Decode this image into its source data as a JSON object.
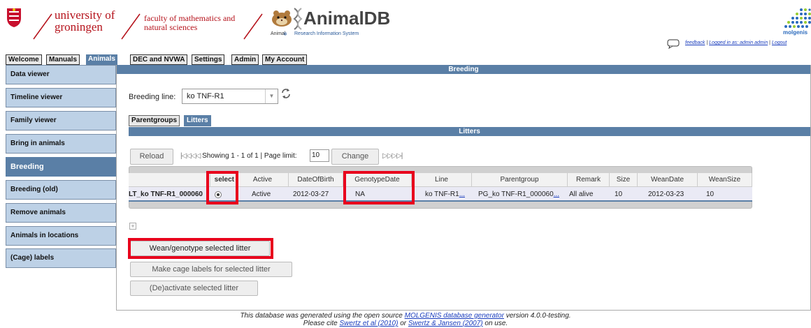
{
  "header": {
    "university_line1": "university of",
    "university_line2": "groningen",
    "faculty_line1": "faculty of mathematics and",
    "faculty_line2": "natural sciences",
    "app_title": "AnimalDB",
    "app_sub_1": "Animal",
    "app_sub_2": "Research Information System",
    "molgenis": "molgenis",
    "feedback": "feedback",
    "sep": "|",
    "logged_in": "Logged in as: admin admin",
    "logout": "Logout"
  },
  "tabs": [
    "Welcome",
    "Manuals",
    "Animals",
    "DEC and NVWA",
    "Settings",
    "Admin",
    "My Account"
  ],
  "sidebar": [
    "Data viewer",
    "Timeline viewer",
    "Family viewer",
    "Bring in animals",
    "Breeding",
    "Breeding (old)",
    "Remove animals",
    "Animals in locations",
    "(Cage) labels"
  ],
  "main": {
    "title": "Breeding",
    "breeding_line_label": "Breeding line:",
    "breeding_line_value": "ko TNF-R1",
    "subtabs": [
      "Parentgroups",
      "Litters"
    ],
    "section_title": "Litters",
    "reload": "Reload",
    "pager_icons_left": "|◁◁◁◁",
    "showing": "Showing 1 - 1 of 1 | Page limit:",
    "page_limit": "10",
    "change": "Change",
    "pager_icons_right": "▷▷▷▷|"
  },
  "table": {
    "columns": [
      "select",
      "Active",
      "DateOfBirth",
      "GenotypeDate",
      "Line",
      "Parentgroup",
      "Remark",
      "Size",
      "WeanDate",
      "WeanSize"
    ],
    "row": {
      "name": "LT_ko TNF-R1_000060",
      "active": "Active",
      "date_of_birth": "2012-03-27",
      "genotype_date": "NA",
      "line": "ko TNF-R1",
      "parentgroup": "PG_ko TNF-R1_000060",
      "dots": "...",
      "remark": "All alive",
      "size": "10",
      "wean_date": "2012-03-23",
      "wean_size": "10"
    }
  },
  "actions": {
    "wean": "Wean/genotype selected litter",
    "cage_labels": "Make cage labels for selected litter",
    "deactivate": "(De)activate selected litter"
  },
  "footer": {
    "line1_a": "This database was generated using the open source ",
    "line1_link": "MOLGENIS database generator",
    "line1_b": " version 4.0.0-testing.",
    "line2_a": "Please cite ",
    "line2_link1": "Swertz et al (2010)",
    "line2_mid": " or ",
    "line2_link2": "Swertz & Jansen (2007)",
    "line2_b": " on use."
  },
  "colors": {
    "brand_red": "#b5121b",
    "accent_blue": "#5a7fa6",
    "sidebar_blue": "#bdd1e6",
    "highlight_red": "#e8001c"
  }
}
